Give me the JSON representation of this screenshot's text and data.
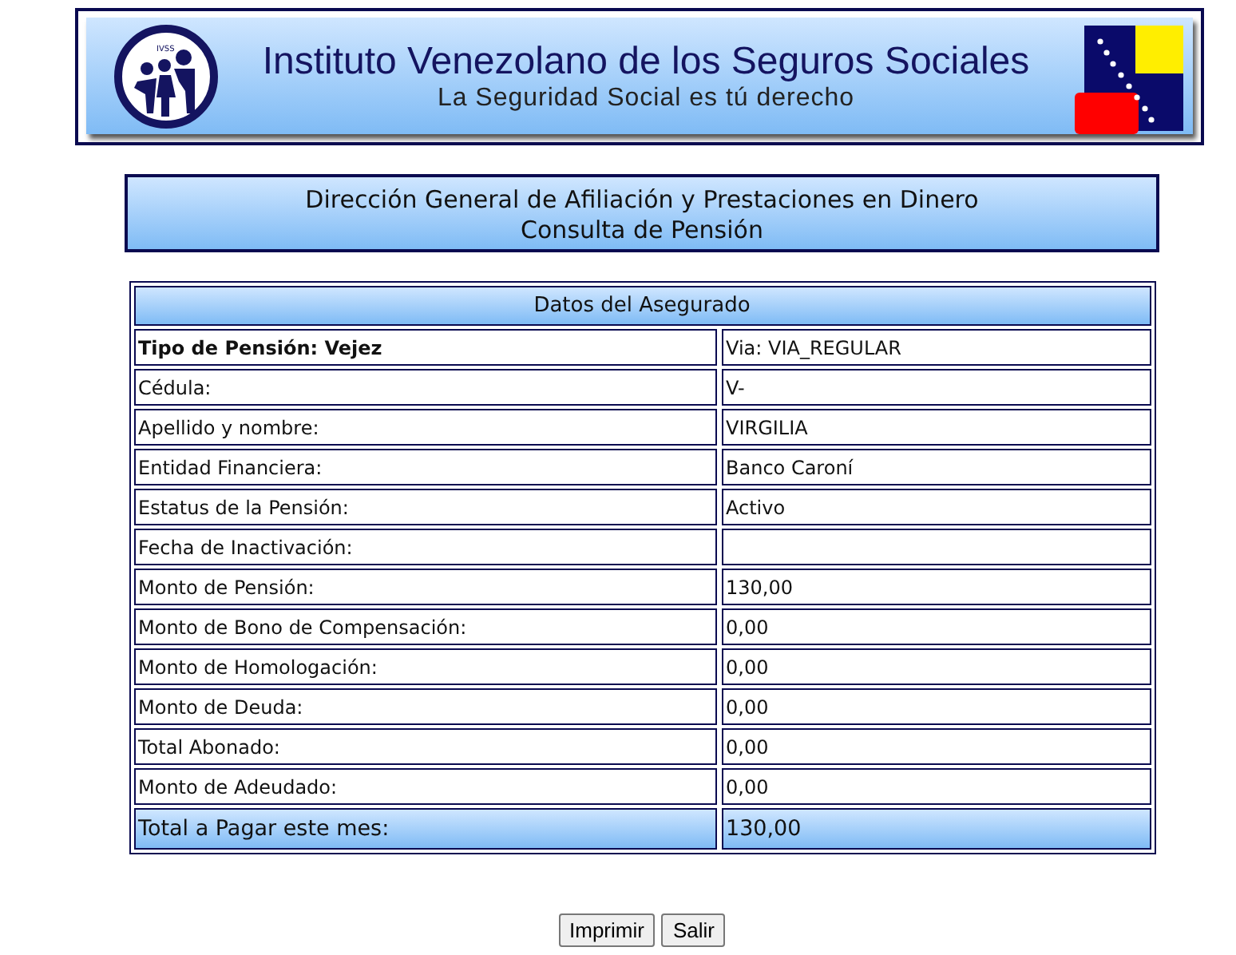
{
  "banner": {
    "title": "Instituto Venezolano de los Seguros Sociales",
    "subtitle": "La Seguridad Social es tú derecho",
    "logo_text": "IVSS"
  },
  "header": {
    "lines": [
      "Dirección General de Afiliación y Prestaciones en Dinero",
      "Consulta de Pensión"
    ]
  },
  "table": {
    "title": "Datos del Asegurado",
    "rows": [
      {
        "kind": "bold",
        "label": "Tipo de Pensión: Vejez",
        "value": "Via: VIA_REGULAR"
      },
      {
        "kind": "normal",
        "label": "Cédula:",
        "value": "V-"
      },
      {
        "kind": "normal",
        "label": "Apellido y nombre:",
        "value": "VIRGILIA"
      },
      {
        "kind": "normal",
        "label": "Entidad Financiera:",
        "value": "Banco Caroní"
      },
      {
        "kind": "normal",
        "label": "Estatus de la Pensión:",
        "value": "Activo"
      },
      {
        "kind": "normal",
        "label": "Fecha de Inactivación:"
      },
      {
        "kind": "normal",
        "label": "Monto de Pensión:",
        "value": "130,00"
      },
      {
        "kind": "normal",
        "label": "Monto de Bono de Compensación:",
        "value": "0,00"
      },
      {
        "kind": "normal",
        "label": "Monto de Homologación:",
        "value": "0,00"
      },
      {
        "kind": "normal",
        "label": "Monto de Deuda:",
        "value": "0,00"
      },
      {
        "kind": "normal",
        "label": "Total Abonado:",
        "value": "0,00"
      },
      {
        "kind": "normal",
        "label": "Monto de Adeudado:",
        "value": "0,00"
      },
      {
        "kind": "total",
        "label": "Total a Pagar este mes:",
        "value": "130,00"
      }
    ]
  },
  "buttons": [
    "Imprimir",
    "Salir"
  ]
}
